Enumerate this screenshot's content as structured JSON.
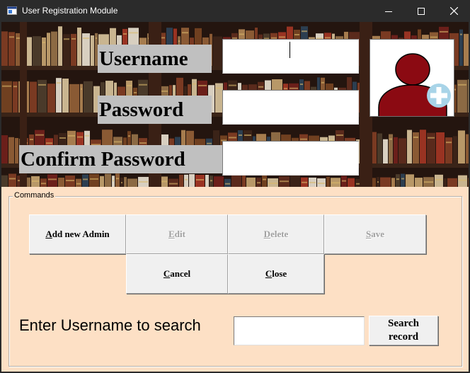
{
  "window": {
    "title": "User Registration Module"
  },
  "form": {
    "username_label": "Username",
    "password_label": "Password",
    "confirm_label": "Confirm Password",
    "username_value": "",
    "password_value": "",
    "confirm_value": ""
  },
  "commands": {
    "legend": "Commands",
    "add_first": "A",
    "add_rest": "dd new Admin",
    "edit_first": "E",
    "edit_rest": "dit",
    "delete_first": "D",
    "delete_rest": "elete",
    "save_first": "S",
    "save_rest": "ave",
    "cancel_first": "C",
    "cancel_rest": "ancel",
    "close_first": "C",
    "close_rest": "lose"
  },
  "search": {
    "label": "Enter Username to search",
    "value": "",
    "button_line1": "Search",
    "button_line2": "record"
  },
  "colors": {
    "panel": "#fde0c5",
    "label_bg": "#c0c0c0",
    "avatar": "#8b0a12",
    "plus_badge": "#a8d4e8"
  },
  "icons": {
    "avatar": "user-add-icon",
    "minimize": "minimize-icon",
    "maximize": "maximize-icon",
    "close": "close-icon"
  }
}
